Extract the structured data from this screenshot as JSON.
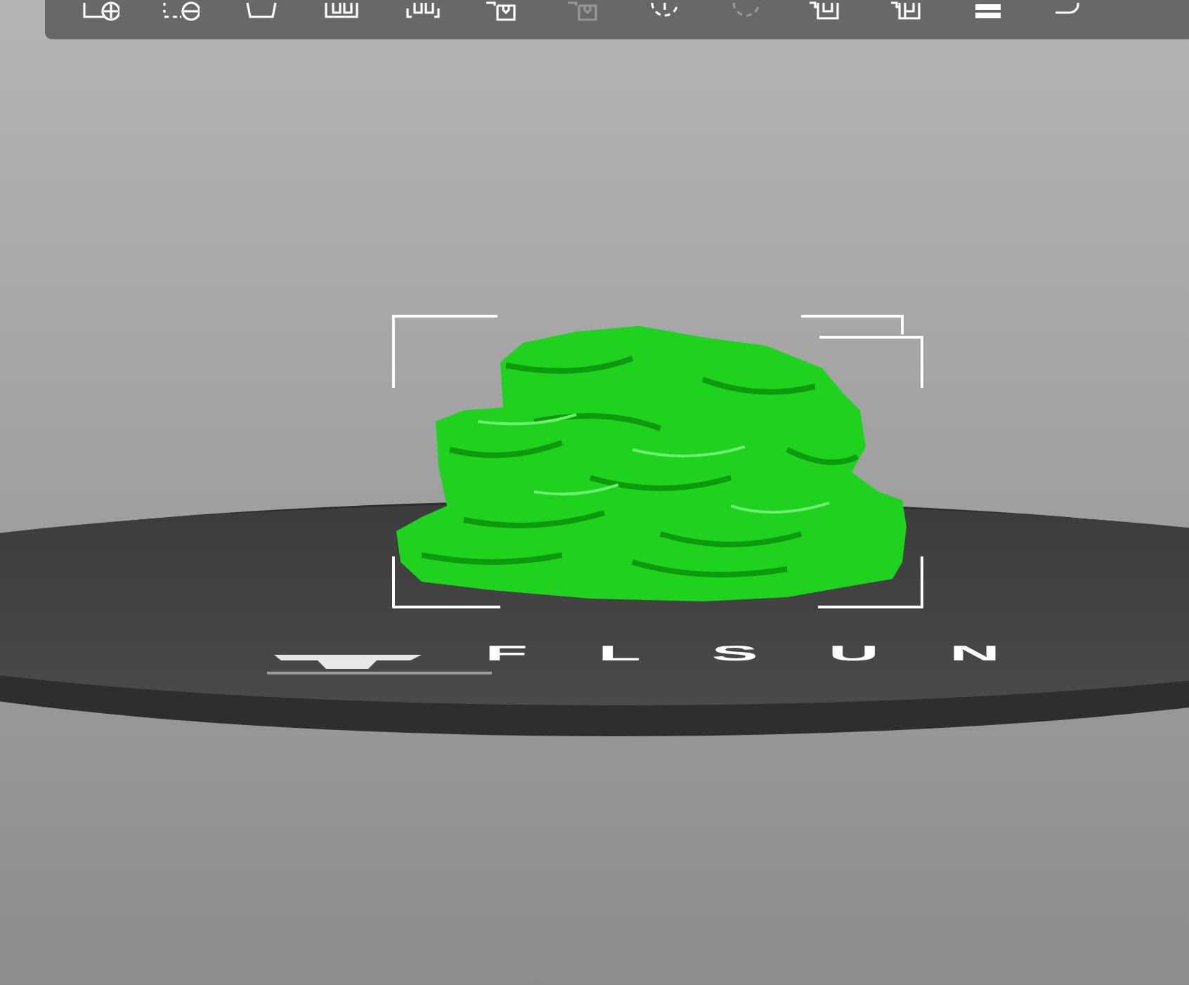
{
  "toolbar": {
    "buttons": [
      {
        "kind": "add",
        "disabled": false
      },
      {
        "kind": "delete",
        "disabled": false
      },
      {
        "kind": "delete-all",
        "disabled": false
      },
      {
        "kind": "arrange",
        "disabled": false
      },
      {
        "kind": "arrange-selection",
        "disabled": false
      },
      {
        "kind": "instance-add",
        "disabled": false
      },
      {
        "kind": "instance-remove",
        "disabled": true
      },
      {
        "kind": "split-objects",
        "disabled": false
      },
      {
        "kind": "split-parts",
        "disabled": true
      },
      {
        "kind": "split-u",
        "disabled": false
      },
      {
        "kind": "split-p",
        "disabled": false
      },
      {
        "kind": "layers",
        "disabled": false
      },
      {
        "kind": "undo",
        "disabled": false
      }
    ]
  },
  "scene": {
    "bed_logo": "FLSUN"
  }
}
